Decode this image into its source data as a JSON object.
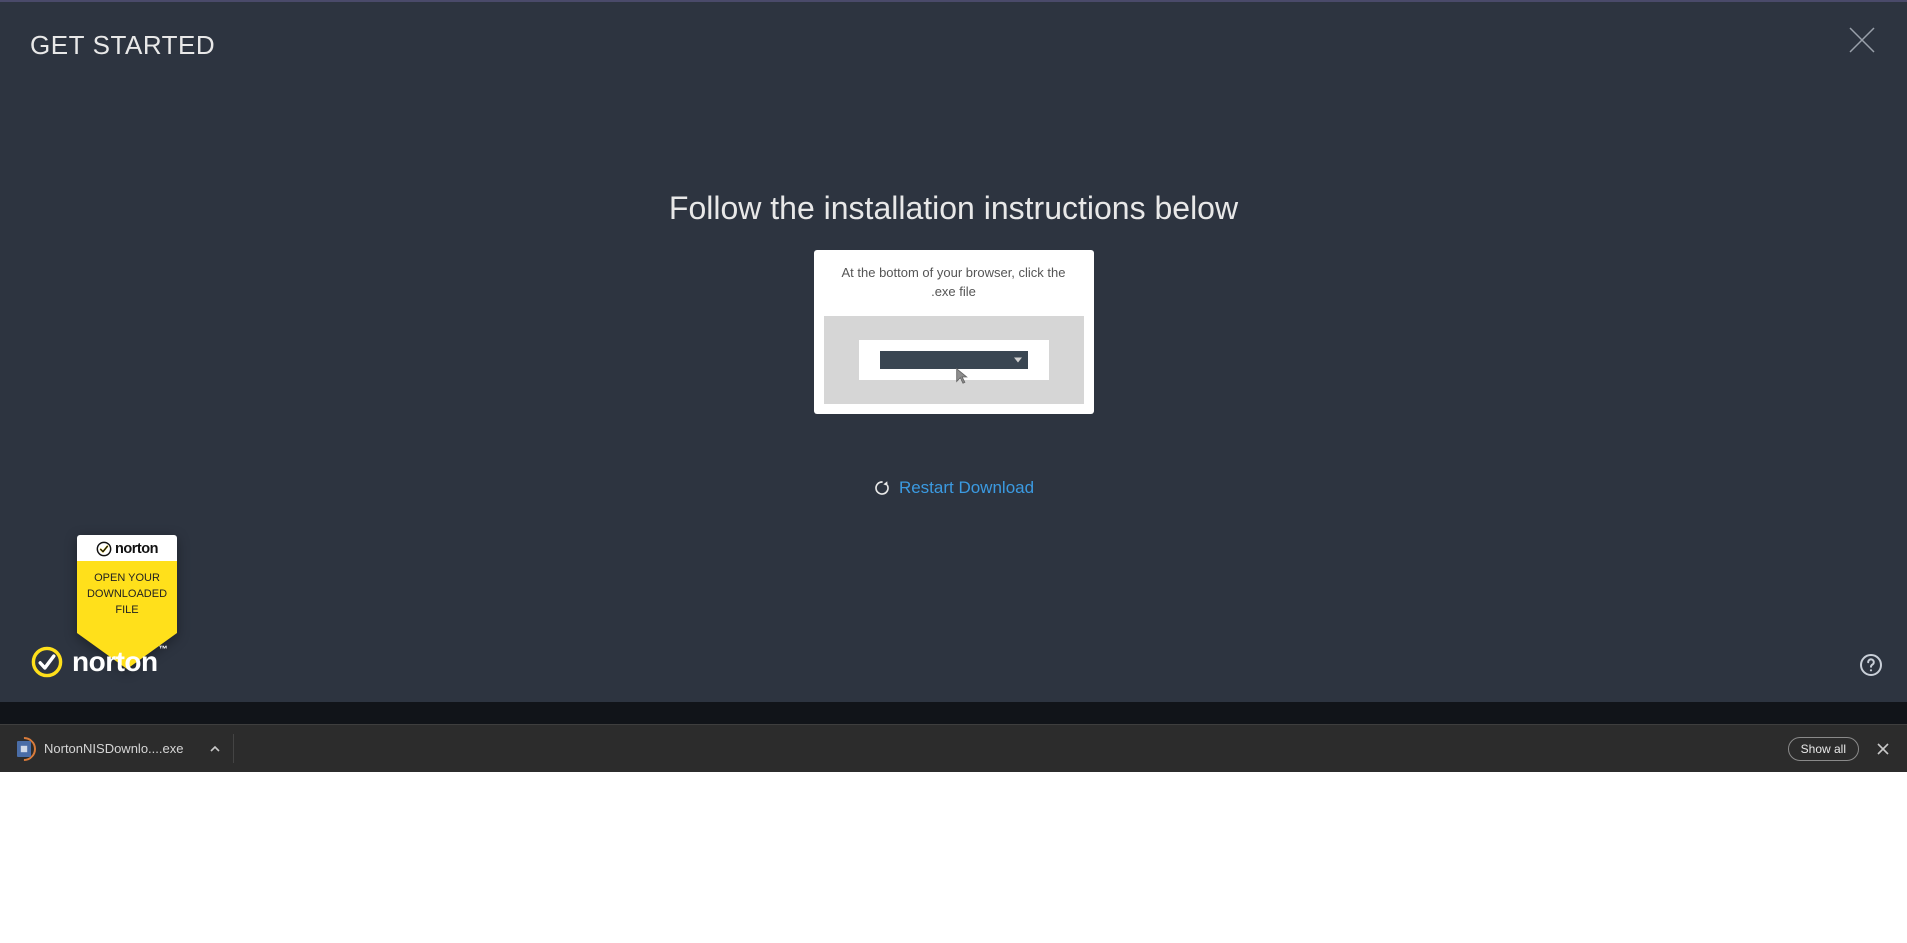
{
  "header": {
    "title_bold": "GET",
    "title_rest": " STARTED"
  },
  "main": {
    "heading": "Follow the installation instructions below",
    "card_text": "At the bottom of your browser, click the .exe file",
    "restart_label": "Restart Download"
  },
  "tooltip": {
    "brand": "norton",
    "line1": "OPEN YOUR",
    "line2": "DOWNLOADED",
    "line3": "FILE"
  },
  "footer": {
    "brand": "norton"
  },
  "download_bar": {
    "filename": "NortonNISDownlo....exe",
    "show_all": "Show all"
  }
}
